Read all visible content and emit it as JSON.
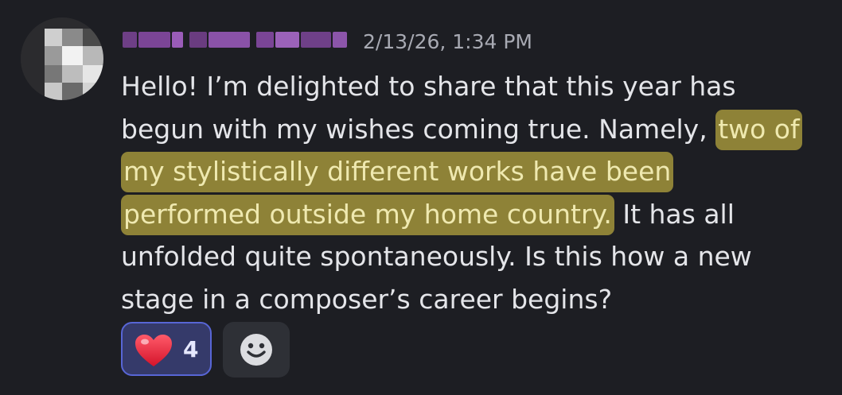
{
  "message": {
    "timestamp": "2/13/26, 1:34 PM",
    "lines": {
      "l1": "Hello! I’m delighted to share that this year has",
      "l2a": "begun with my wishes coming true. Namely,",
      "l2b": "two of",
      "l3": "my stylistically different works have been",
      "l4a": "performed outside my home country.",
      "l4b": "It has all",
      "l5": "unfolded quite spontaneously. Is this how a new",
      "l6": "stage in a composer’s career begins?"
    }
  },
  "reactions": [
    {
      "emoji": "heart-icon",
      "count": "4",
      "selected": true
    }
  ],
  "add_reaction": {
    "icon": "smile-plus-icon"
  },
  "colors": {
    "background": "#1d1e23",
    "highlight": "#8e8237",
    "reaction_selected_bg": "#353a6a",
    "reaction_selected_border": "#5866d6",
    "username": "#9b59b6"
  }
}
